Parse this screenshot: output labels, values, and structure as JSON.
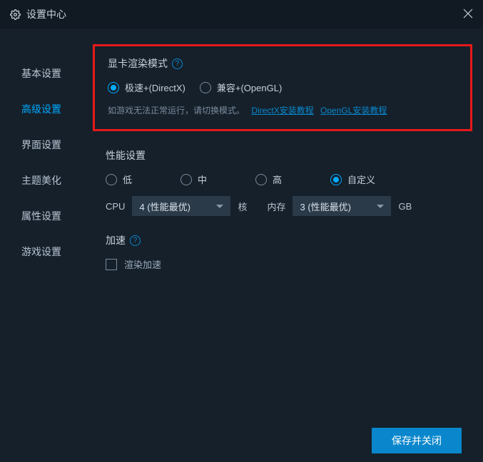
{
  "titlebar": {
    "title": "设置中心"
  },
  "sidebar": {
    "items": [
      {
        "label": "基本设置"
      },
      {
        "label": "高级设置"
      },
      {
        "label": "界面设置"
      },
      {
        "label": "主题美化"
      },
      {
        "label": "属性设置"
      },
      {
        "label": "游戏设置"
      }
    ]
  },
  "render": {
    "title": "显卡渲染模式",
    "opt1": "极速+(DirectX)",
    "opt2": "兼容+(OpenGL)",
    "hint": "如游戏无法正常运行，请切换模式。",
    "link1": "DirectX安装教程",
    "link2": "OpenGL安装教程"
  },
  "perf": {
    "title": "性能设置",
    "low": "低",
    "mid": "中",
    "high": "高",
    "custom": "自定义",
    "cpu_label": "CPU",
    "cpu_value": "4 (性能最优)",
    "core_label": "核",
    "mem_label": "内存",
    "mem_value": "3 (性能最优)",
    "gb_label": "GB"
  },
  "accel": {
    "title": "加速",
    "render_accel": "渲染加速"
  },
  "footer": {
    "save": "保存并关闭"
  }
}
